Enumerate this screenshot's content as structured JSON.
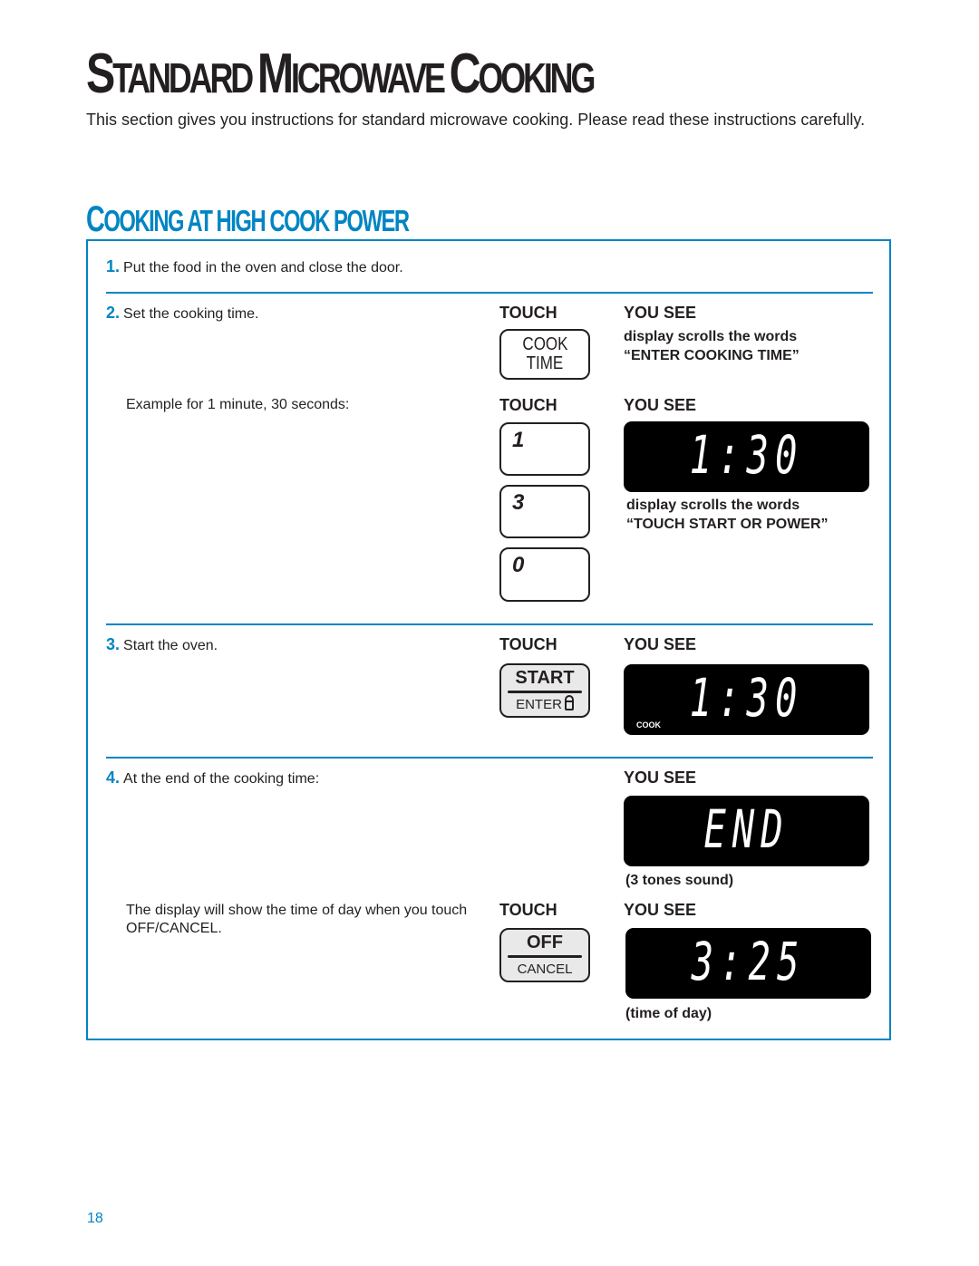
{
  "page": {
    "title_parts": [
      {
        "cap": "S",
        "rest": "TANDARD "
      },
      {
        "cap": "M",
        "rest": "ICROWAVE "
      },
      {
        "cap": "C",
        "rest": "OOKING"
      }
    ],
    "intro": "This section gives you instructions for standard microwave cooking. Please read these instructions carefully.",
    "page_number": "18",
    "accent_color": "#0085c3"
  },
  "section": {
    "title_parts": [
      {
        "cap": "C",
        "rest": "OOKING AT HIGH COOK POWER"
      }
    ]
  },
  "labels": {
    "touch": "TOUCH",
    "you_see": "YOU SEE"
  },
  "steps": [
    {
      "number": "1.",
      "text": "Put the food in the oven and close the door."
    },
    {
      "number": "2.",
      "text": "Set the cooking time.",
      "key": {
        "line1": "COOK",
        "line2": "TIME"
      },
      "result_line1": "display scrolls the words",
      "result_line2": "“ENTER COOKING TIME”",
      "example": "Example for 1 minute, 30 seconds:",
      "digit_keys": [
        "1",
        "3",
        "0"
      ],
      "display": "1:30",
      "result2_line1": "display scrolls the words",
      "result2_line2": "“TOUCH START OR POWER”"
    },
    {
      "number": "3.",
      "text": "Start the oven.",
      "key": {
        "top": "START",
        "bottom": "ENTER",
        "icon": "lock-icon"
      },
      "display": "1:30",
      "display_mode": "COOK"
    },
    {
      "number": "4.",
      "text": "At the end of the cooking time:",
      "display": "END",
      "display_note": "(3 tones sound)",
      "subtext": "The display will show the time of day when you touch OFF/CANCEL.",
      "key": {
        "top": "OFF",
        "bottom": "CANCEL"
      },
      "display2": "3:25",
      "display2_note": "(time of day)"
    }
  ]
}
